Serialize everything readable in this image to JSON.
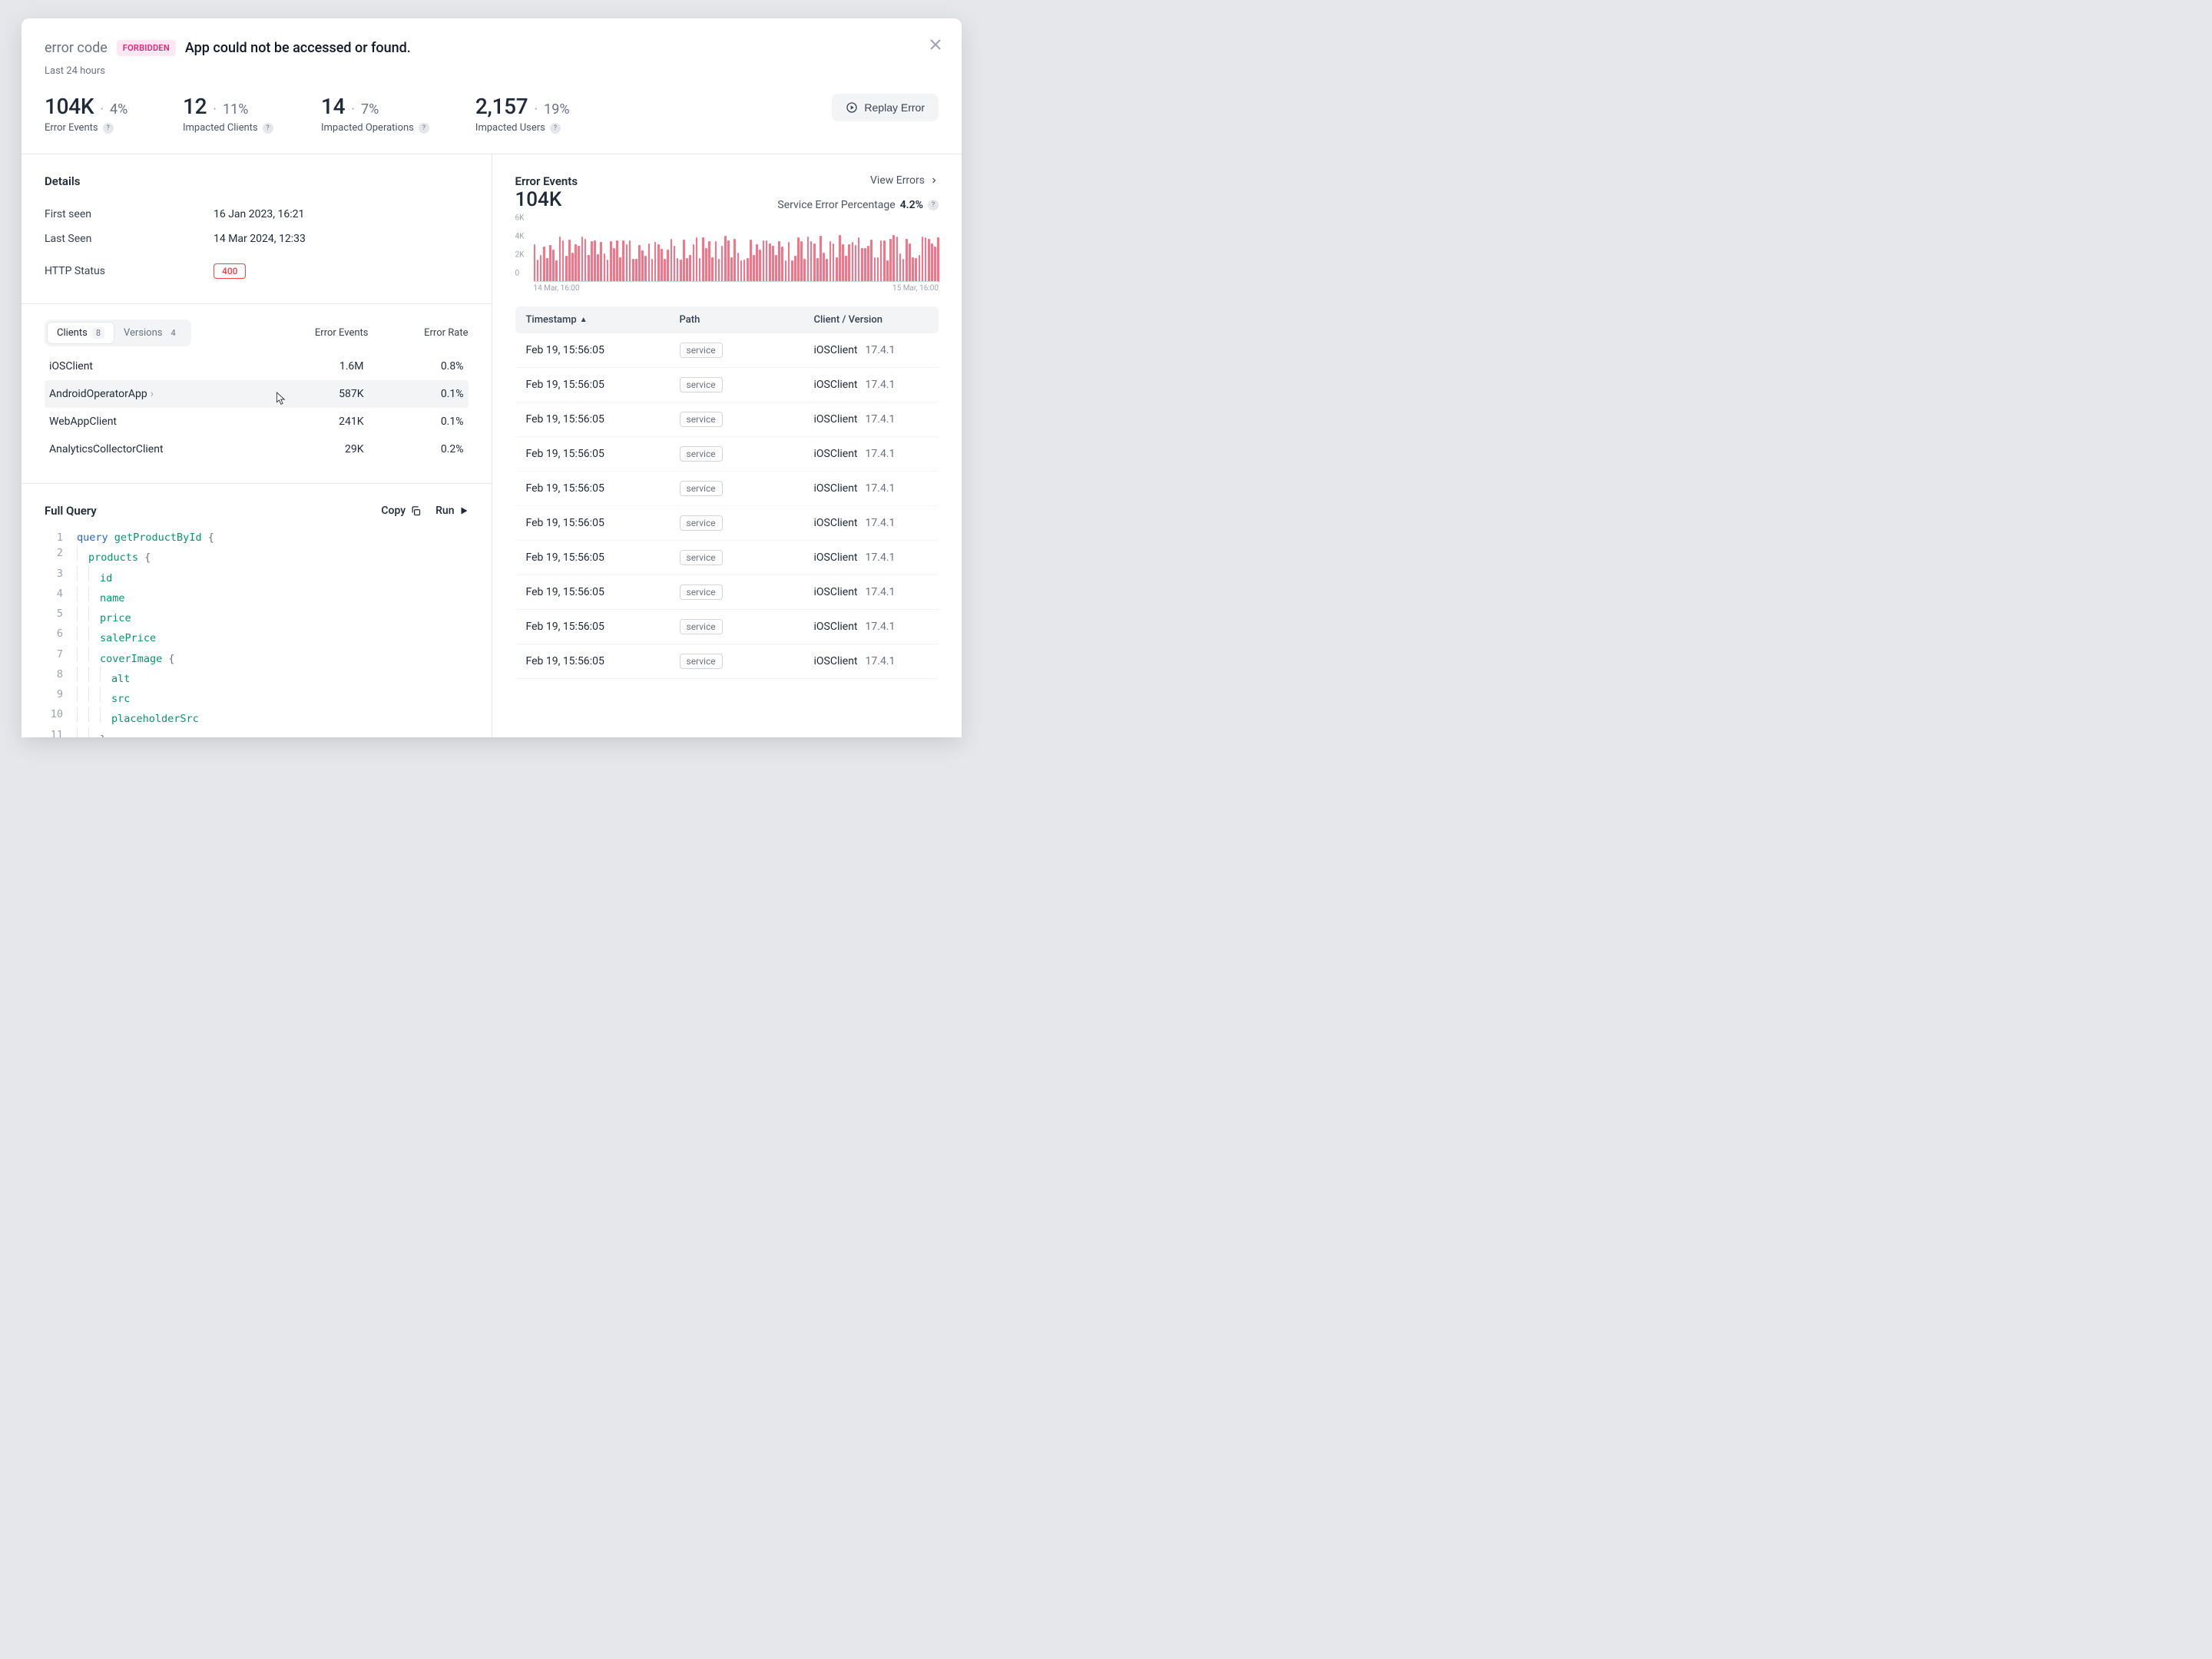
{
  "header": {
    "label": "error code",
    "badge": "FORBIDDEN",
    "message": "App could not be accessed or found.",
    "timeframe": "Last 24 hours",
    "replay": "Replay Error"
  },
  "stats": [
    {
      "value": "104K",
      "pct": "4%",
      "label": "Error Events"
    },
    {
      "value": "12",
      "pct": "11%",
      "label": "Impacted Clients"
    },
    {
      "value": "14",
      "pct": "7%",
      "label": "Impacted Operations"
    },
    {
      "value": "2,157",
      "pct": "19%",
      "label": "Impacted Users"
    }
  ],
  "details": {
    "title": "Details",
    "rows": [
      {
        "key": "First seen",
        "val": "16 Jan 2023, 16:21"
      },
      {
        "key": "Last Seen",
        "val": "14 Mar 2024, 12:33"
      }
    ],
    "http_label": "HTTP Status",
    "http_value": "400"
  },
  "tabs": {
    "clients": {
      "label": "Clients",
      "count": "8"
    },
    "versions": {
      "label": "Versions",
      "count": "4"
    }
  },
  "client_headers": {
    "events": "Error Events",
    "rate": "Error Rate"
  },
  "clients": [
    {
      "name": "iOSClient",
      "events": "1.6M",
      "rate": "0.8%",
      "hover": false
    },
    {
      "name": "AndroidOperatorApp",
      "events": "587K",
      "rate": "0.1%",
      "hover": true
    },
    {
      "name": "WebAppClient",
      "events": "241K",
      "rate": "0.1%",
      "hover": false
    },
    {
      "name": "AnalyticsCollectorClient",
      "events": "29K",
      "rate": "0.2%",
      "hover": false
    }
  ],
  "query": {
    "title": "Full Query",
    "copy": "Copy",
    "run": "Run",
    "lines": [
      [
        {
          "cls": "tk-kw",
          "t": "query"
        },
        {
          "cls": "",
          "t": " "
        },
        {
          "cls": "tk-name",
          "t": "getProductById"
        },
        {
          "cls": "",
          "t": " "
        },
        {
          "cls": "tk-brace",
          "t": "{"
        }
      ],
      [
        {
          "cls": "tk-field",
          "t": "products"
        },
        {
          "cls": "",
          "t": " "
        },
        {
          "cls": "tk-brace",
          "t": "{"
        }
      ],
      [
        {
          "cls": "tk-field",
          "t": "id"
        }
      ],
      [
        {
          "cls": "tk-field",
          "t": "name"
        }
      ],
      [
        {
          "cls": "tk-field",
          "t": "price"
        }
      ],
      [
        {
          "cls": "tk-field",
          "t": "salePrice"
        }
      ],
      [
        {
          "cls": "tk-field",
          "t": "coverImage"
        },
        {
          "cls": "",
          "t": " "
        },
        {
          "cls": "tk-brace",
          "t": "{"
        }
      ],
      [
        {
          "cls": "tk-field",
          "t": "alt"
        }
      ],
      [
        {
          "cls": "tk-field",
          "t": "src"
        }
      ],
      [
        {
          "cls": "tk-field",
          "t": "placeholderSrc"
        }
      ],
      [
        {
          "cls": "tk-brace",
          "t": "}"
        }
      ],
      [
        {
          "cls": "tk-brace",
          "t": "}"
        }
      ],
      [
        {
          "cls": "tk-brace",
          "t": "}"
        }
      ]
    ],
    "indents": [
      0,
      1,
      2,
      2,
      2,
      2,
      2,
      3,
      3,
      3,
      2,
      1,
      0
    ]
  },
  "events": {
    "title": "Error Events",
    "link": "View Errors",
    "big": "104K",
    "svc_label": "Service Error Percentage",
    "svc_val": "4.2%",
    "headers": {
      "ts": "Timestamp",
      "path": "Path",
      "cv": "Client / Version"
    },
    "rows": [
      {
        "ts": "Feb 19, 15:56:05",
        "path": "service",
        "client": "iOSClient",
        "ver": "17.4.1"
      },
      {
        "ts": "Feb 19, 15:56:05",
        "path": "service",
        "client": "iOSClient",
        "ver": "17.4.1"
      },
      {
        "ts": "Feb 19, 15:56:05",
        "path": "service",
        "client": "iOSClient",
        "ver": "17.4.1"
      },
      {
        "ts": "Feb 19, 15:56:05",
        "path": "service",
        "client": "iOSClient",
        "ver": "17.4.1"
      },
      {
        "ts": "Feb 19, 15:56:05",
        "path": "service",
        "client": "iOSClient",
        "ver": "17.4.1"
      },
      {
        "ts": "Feb 19, 15:56:05",
        "path": "service",
        "client": "iOSClient",
        "ver": "17.4.1"
      },
      {
        "ts": "Feb 19, 15:56:05",
        "path": "service",
        "client": "iOSClient",
        "ver": "17.4.1"
      },
      {
        "ts": "Feb 19, 15:56:05",
        "path": "service",
        "client": "iOSClient",
        "ver": "17.4.1"
      },
      {
        "ts": "Feb 19, 15:56:05",
        "path": "service",
        "client": "iOSClient",
        "ver": "17.4.1"
      },
      {
        "ts": "Feb 19, 15:56:05",
        "path": "service",
        "client": "iOSClient",
        "ver": "17.4.1"
      }
    ]
  },
  "chart_data": {
    "type": "bar",
    "title": "Error Events",
    "xlabel": "",
    "ylabel": "",
    "ylim": [
      0,
      6000
    ],
    "yticks": [
      "0",
      "2K",
      "4K",
      "6K"
    ],
    "x_start": "14 Mar, 16:00",
    "x_end": "15 Mar, 16:00",
    "values": [
      4100,
      2400,
      2900,
      3800,
      2600,
      4000,
      3500,
      2300,
      4900,
      4500,
      2800,
      4600,
      3200,
      4100,
      3900,
      4900,
      4700,
      2900,
      4400,
      4500,
      3000,
      4300,
      3100,
      2400,
      4400,
      3700,
      4500,
      2700,
      4500,
      4100,
      4500,
      2500,
      2500,
      4000,
      3400,
      2800,
      4200,
      2500,
      4300,
      4100,
      3600,
      2500,
      3500,
      4700,
      3900,
      2600,
      2400,
      4600,
      2600,
      2900,
      4100,
      4800,
      2600,
      4800,
      3700,
      4400,
      2700,
      4400,
      2500,
      3900,
      5000,
      4500,
      2700,
      4700,
      3200,
      2300,
      2400,
      2600,
      4600,
      2900,
      4100,
      3500,
      4500,
      4500,
      4200,
      3900,
      2900,
      4400,
      3800,
      2300,
      4300,
      2300,
      2800,
      4800,
      4400,
      2500,
      4900,
      4400,
      4200,
      2600,
      5000,
      3200,
      2500,
      4400,
      4200,
      2700,
      5100,
      4100,
      2800,
      4100,
      4300,
      4000,
      4800,
      3700,
      3700,
      3900,
      4600,
      2700,
      2700,
      4500,
      4500,
      2300,
      4700,
      5100,
      4900,
      3100,
      2500,
      4700,
      4200,
      2700,
      2600,
      2900,
      4900,
      4800,
      4700,
      4200,
      3800,
      4800
    ]
  }
}
